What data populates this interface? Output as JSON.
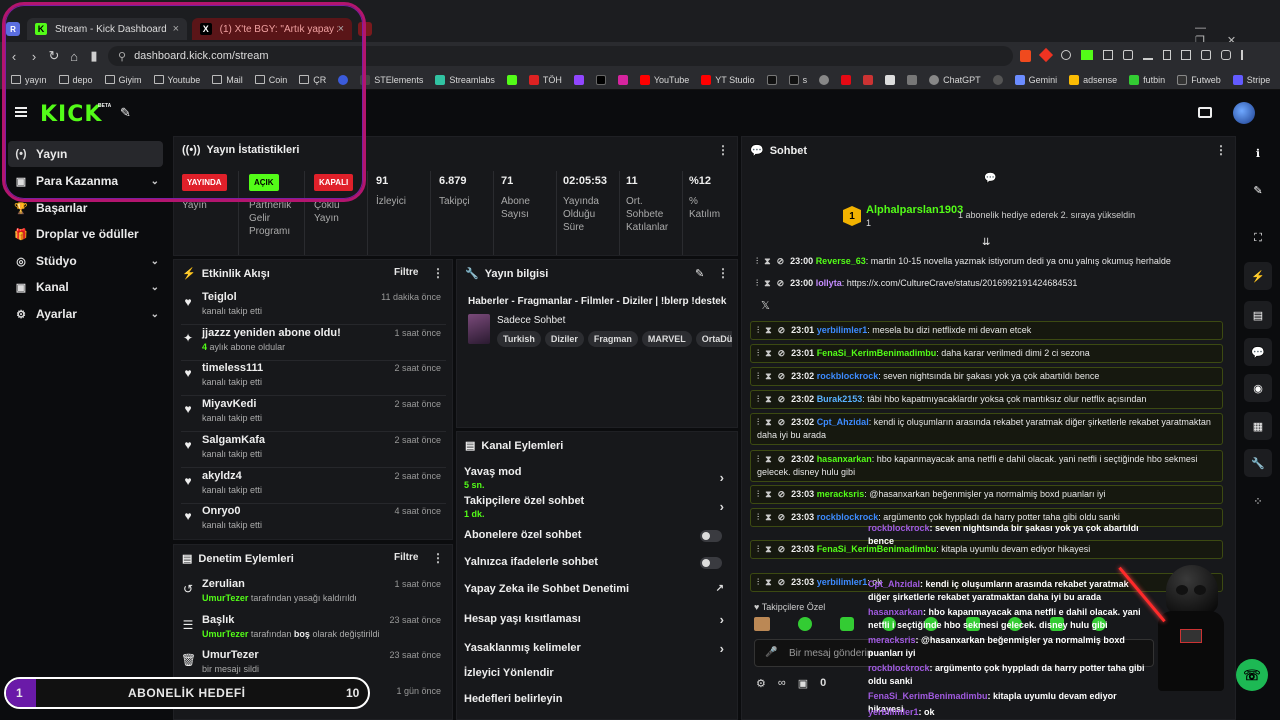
{
  "browser": {
    "tabs": [
      {
        "title": "Stream - Kick Dashboard",
        "close": "×"
      },
      {
        "title": "(1) X'te BGY: \"Artık yapay zeka botlar",
        "close": "×"
      }
    ],
    "url": "dashboard.kick.com/stream",
    "bookmarks": [
      "yayın",
      "depo",
      "Giyim",
      "Youtube",
      "Mail",
      "Coin",
      "ÇR",
      "STElements",
      "Streamlabs",
      "TÖH",
      "YouTube",
      "YT Studio",
      "s",
      "ChatGPT",
      "Gemini",
      "adsense",
      "futbin",
      "Futweb",
      "Stripe"
    ],
    "more": "»"
  },
  "kick": {
    "logo": "KICK",
    "beta": "BETA"
  },
  "sidebar": {
    "items": [
      {
        "label": "Yayın",
        "icon": "(•)"
      },
      {
        "label": "Para Kazanma",
        "icon": "▣"
      },
      {
        "label": "Başarılar",
        "icon": "🏆"
      },
      {
        "label": "Droplar ve ödüller",
        "icon": "🎁"
      },
      {
        "label": "Stüdyo",
        "icon": "◎"
      },
      {
        "label": "Kanal",
        "icon": "▣"
      },
      {
        "label": "Ayarlar",
        "icon": "⚙"
      }
    ]
  },
  "stats": {
    "title": "Yayın İstatistikleri",
    "dots": "⋮",
    "badges": [
      "YAYINDA",
      "AÇIK",
      "KAPALI"
    ],
    "badge_labels": [
      "Yayın",
      "Partnerlik Gelir Programı",
      "Çoklu Yayın"
    ],
    "values": [
      {
        "value": "91",
        "label": "İzleyici"
      },
      {
        "value": "6.879",
        "label": "Takipçi"
      },
      {
        "value": "71",
        "label": "Abone Sayısı"
      },
      {
        "value": "02:05:53",
        "label": "Yayında Olduğu Süre"
      },
      {
        "value": "11",
        "label": "Ort. Sohbete Katılanlar"
      },
      {
        "value": "%12",
        "label": "% Katılım"
      }
    ]
  },
  "activity": {
    "title": "Etkinlik Akışı",
    "filter": "Filtre",
    "items": [
      {
        "name": "Teiglol",
        "sub": "kanalı takip etti",
        "time": "11 dakika önce",
        "icon": "♥"
      },
      {
        "name": "jjazzz yeniden abone oldu!",
        "sub_g": "4",
        "sub": "aylık abone oldular",
        "time": "1 saat önce",
        "icon": "✦"
      },
      {
        "name": "timeless111",
        "sub": "kanalı takip etti",
        "time": "2 saat önce",
        "icon": "♥"
      },
      {
        "name": "MiyavKedi",
        "sub": "kanalı takip etti",
        "time": "2 saat önce",
        "icon": "♥"
      },
      {
        "name": "SalgamKafa",
        "sub": "kanalı takip etti",
        "time": "2 saat önce",
        "icon": "♥"
      },
      {
        "name": "akyldz4",
        "sub": "kanalı takip etti",
        "time": "2 saat önce",
        "icon": "♥"
      },
      {
        "name": "Onryo0",
        "sub": "kanalı takip etti",
        "time": "4 saat önce",
        "icon": "♥"
      }
    ]
  },
  "moderation": {
    "title": "Denetim Eylemleri",
    "filter": "Filtre",
    "items": [
      {
        "name": "Zerulian",
        "actor": "UmurTezer",
        "sub": "tarafından yasağı kaldırıldı",
        "time": "1 saat önce",
        "icon": "↺"
      },
      {
        "name": "Başlık",
        "actor": "UmurTezer",
        "sub_pre": "tarafından",
        "bold": "boş",
        "sub": "olarak değiştirildi",
        "time": "23 saat önce",
        "icon": "☰"
      },
      {
        "name": "UmurTezer",
        "sub": "bir mesajı sildi",
        "time": "23 saat önce",
        "icon": "🗑"
      },
      {
        "name": "",
        "sub": "",
        "time": "1 gün önce",
        "icon": ""
      }
    ]
  },
  "stream_info": {
    "title": "Yayın bilgisi",
    "stream_title": "Haberler - Fragmanlar - Filmler - Diziler | !blerp !destek",
    "category": "Sadece Sohbet",
    "tags": [
      "Turkish",
      "Diziler",
      "Fragman",
      "MARVEL",
      "OrtaDünya"
    ]
  },
  "channel_actions": {
    "title": "Kanal Eylemleri",
    "items": [
      {
        "label": "Yavaş mod",
        "sub": "5 sn.",
        "control": "arrow"
      },
      {
        "label": "Takipçilere özel sohbet",
        "sub": "1 dk.",
        "control": "arrow"
      },
      {
        "label": "Abonelere özel sohbet",
        "sub": "",
        "control": "toggle"
      },
      {
        "label": "Yalnızca ifadelerle sohbet",
        "sub": "",
        "control": "toggle"
      },
      {
        "label": "Yapay Zeka ile Sohbet Denetimi",
        "sub": "",
        "control": "external"
      },
      {
        "label": "Hesap yaşı kısıtlaması",
        "sub": "",
        "control": "arrow"
      },
      {
        "label": "Yasaklanmış kelimeler",
        "sub": "",
        "control": "arrow"
      },
      {
        "label": "İzleyici Yönlendir",
        "sub": "",
        "control": ""
      },
      {
        "label": "Hedefleri belirleyin",
        "sub": "",
        "control": ""
      }
    ]
  },
  "chat": {
    "title": "Sohbet",
    "pinned_user": "Alphalparslan1903",
    "pinned_count": "1",
    "pinned_note": "1 abonelik hediye ederek 2. sıraya yükseldin",
    "messages": [
      {
        "time": "23:00",
        "user": "Reverse_63",
        "color": "#53fc18",
        "text": "martin 10-15 novella yazmak istiyorum dedi ya onu yalnış okumuş herhalde",
        "hl": false
      },
      {
        "time": "23:00",
        "user": "lollyta",
        "color": "#c58cff",
        "text": "https://x.com/CultureCrave/status/2016992191424684531",
        "hl": false
      },
      {
        "time": "23:01",
        "user": "yerbilimler1",
        "color": "#3d8bff",
        "text": "mesela bu dizi netflixde mi devam etcek",
        "hl": true
      },
      {
        "time": "23:01",
        "user": "FenaSi_KerimBenimadimbu",
        "color": "#53fc18",
        "text": "daha karar verilmedi dimi 2 ci sezona",
        "hl": true
      },
      {
        "time": "23:02",
        "user": "rockblockrock",
        "color": "#3d8bff",
        "text": "seven nightsında bir şakası yok ya çok abartıldı bence",
        "hl": true
      },
      {
        "time": "23:02",
        "user": "Burak2153",
        "color": "#5ab2ff",
        "text": "tâbi hbo kapatmıyacaklardır yoksa çok mantıksız olur netflix açısından",
        "hl": true
      },
      {
        "time": "23:02",
        "user": "Cpt_Ahzidal",
        "color": "#3d8bff",
        "text": "kendi iç oluşumların arasında rekabet yaratmak diğer şirketlerle rekabet yaratmaktan daha iyi bu arada",
        "hl": true
      },
      {
        "time": "23:02",
        "user": "hasanxarkan",
        "color": "#53fc18",
        "text": "hbo kapanmayacak ama netfli e dahil olacak. yani netfli i seçtiğinde hbo sekmesi gelecek. disney hulu gibi",
        "hl": true
      },
      {
        "time": "23:03",
        "user": "meracksris",
        "color": "#53fc18",
        "text": "@hasanxarkan beğenmişler ya normalmiş boxd puanları iyi",
        "hl": true
      },
      {
        "time": "23:03",
        "user": "rockblockrock",
        "color": "#3d8bff",
        "text": "argümento çok hyppladı da harry potter taha gibi oldu sanki",
        "hl": true
      },
      {
        "time": "23:03",
        "user": "FenaSi_KerimBenimadimbu",
        "color": "#53fc18",
        "text": "kitapla uyumlu devam ediyor hikayesi",
        "hl": true
      },
      {
        "time": "23:03",
        "user": "yerbilimler1",
        "color": "#3d8bff",
        "text": "ok",
        "hl": true
      }
    ],
    "overlay": [
      {
        "user": "rockblockrock",
        "text": ": seven nightsında bir şakası yok ya çok abartıldı bence"
      },
      {
        "user": "Cpt_Ahzidal",
        "text": ": kendi iç oluşumların arasında rekabet yaratmak diğer şirketlerle rekabet yaratmaktan daha iyi bu arada"
      },
      {
        "user": "hasanxarkan",
        "text": ": hbo kapanmayacak ama netfli e dahil olacak. yani netfli i seçtiğinde hbo sekmesi gelecek. disney hulu gibi"
      },
      {
        "user": "meracksris",
        "text": ": @hasanxarkan beğenmişler ya normalmiş boxd puanları iyi"
      },
      {
        "user": "rockblockrock",
        "text": ": argümento çok hyppladı da harry potter taha gibi oldu sanki"
      },
      {
        "user": "FenaSi_KerimBenimadimbu",
        "text": ": kitapla uyumlu devam ediyor hikayesi"
      },
      {
        "user": "yerbilimler1",
        "text": ": ok"
      }
    ],
    "follower_label": "Takipçilere Özel",
    "input_placeholder": "Bir mesaj gönderin",
    "viewer_count": "0"
  },
  "goal": {
    "num": "1",
    "label": "ABONELİK HEDEFİ",
    "target": "10"
  },
  "colors": {
    "kick_green": "#53fc18",
    "annotation": "#b3156e"
  }
}
